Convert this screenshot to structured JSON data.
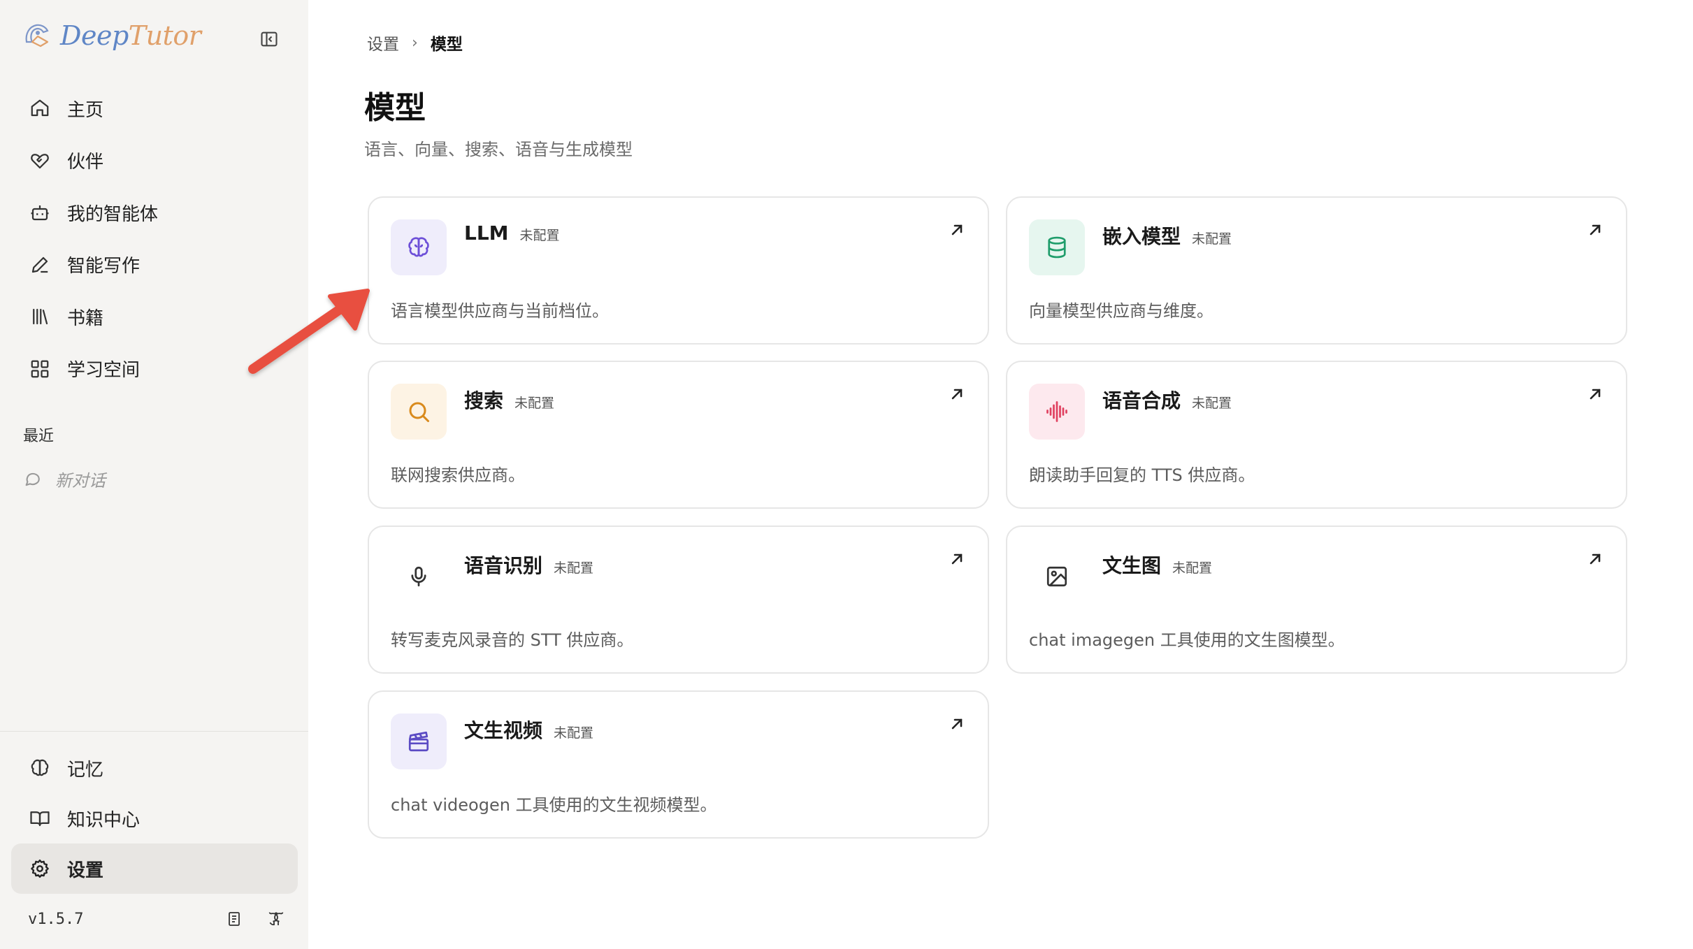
{
  "app": {
    "logo_text_part1": "Deep",
    "logo_text_part2": "Tutor"
  },
  "sidebar": {
    "nav": [
      {
        "label": "主页",
        "icon": "home-icon"
      },
      {
        "label": "伙伴",
        "icon": "heart-handshake-icon"
      },
      {
        "label": "我的智能体",
        "icon": "bot-icon"
      },
      {
        "label": "智能写作",
        "icon": "pen-icon"
      },
      {
        "label": "书籍",
        "icon": "library-icon"
      },
      {
        "label": "学习空间",
        "icon": "grid-icon"
      }
    ],
    "recent_title": "最近",
    "recent_items": [
      {
        "label": "新对话",
        "icon": "chat-icon"
      }
    ],
    "bottom_nav": [
      {
        "label": "记忆",
        "icon": "brain-icon",
        "active": false
      },
      {
        "label": "知识中心",
        "icon": "book-open-icon",
        "active": false
      },
      {
        "label": "设置",
        "icon": "gear-icon",
        "active": true
      }
    ],
    "version": "v1.5.7"
  },
  "breadcrumb": {
    "parent": "设置",
    "separator": "›",
    "current": "模型"
  },
  "page": {
    "title": "模型",
    "subtitle": "语言、向量、搜索、语音与生成模型"
  },
  "cards": [
    {
      "name": "LLM",
      "status": "未配置",
      "description": "语言模型供应商与当前档位。",
      "icon": "brain-icon",
      "icon_bg": "#efedfb",
      "icon_color": "#6d4fd8"
    },
    {
      "name": "嵌入模型",
      "status": "未配置",
      "description": "向量模型供应商与维度。",
      "icon": "database-icon",
      "icon_bg": "#e6f6ef",
      "icon_color": "#1f9d6b"
    },
    {
      "name": "搜索",
      "status": "未配置",
      "description": "联网搜索供应商。",
      "icon": "search-icon",
      "icon_bg": "#fdf3e4",
      "icon_color": "#d98a1c"
    },
    {
      "name": "语音合成",
      "status": "未配置",
      "description": "朗读助手回复的 TTS 供应商。",
      "icon": "audio-waveform-icon",
      "icon_bg": "#fde9ee",
      "icon_color": "#e0405f"
    },
    {
      "name": "语音识别",
      "status": "未配置",
      "description": "转写麦克风录音的 STT 供应商。",
      "icon": "microphone-icon",
      "icon_bg": "#ffffff",
      "icon_color": "#333333"
    },
    {
      "name": "文生图",
      "status": "未配置",
      "description": "chat imagegen 工具使用的文生图模型。",
      "icon": "image-icon",
      "icon_bg": "#ffffff",
      "icon_color": "#333333"
    },
    {
      "name": "文生视频",
      "status": "未配置",
      "description": "chat videogen 工具使用的文生视频模型。",
      "icon": "clapperboard-icon",
      "icon_bg": "#efedfb",
      "icon_color": "#5b4bc4"
    }
  ],
  "colors": {
    "sidebar_bg": "#f5f4f2",
    "annotation_arrow": "#e8503f"
  }
}
